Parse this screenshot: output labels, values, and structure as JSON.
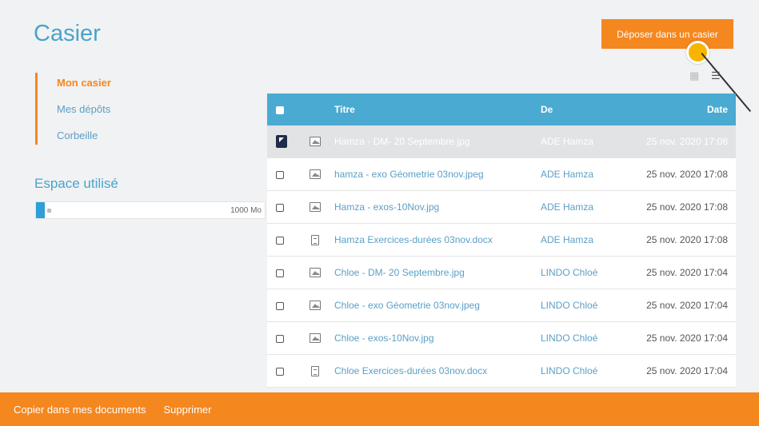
{
  "header": {
    "title": "Casier",
    "deposit_label": "Déposer dans un casier"
  },
  "sidebar": {
    "items": [
      {
        "label": "Mon casier",
        "active": true
      },
      {
        "label": "Mes dépôts",
        "active": false
      },
      {
        "label": "Corbeille",
        "active": false
      }
    ],
    "space": {
      "title": "Espace utilisé",
      "total": "1000 Mo",
      "used_fraction": 0.04
    }
  },
  "view": {
    "grid_icon": "grid-view-icon",
    "list_icon": "list-view-icon",
    "active": "list"
  },
  "table": {
    "headers": {
      "title": "Titre",
      "from": "De",
      "date": "Date"
    },
    "rows": [
      {
        "type": "image",
        "title": "Hamza - DM- 20 Septembre.jpg",
        "from": "ADE Hamza",
        "date": "25 nov. 2020 17:08",
        "selected": true
      },
      {
        "type": "image",
        "title": "hamza - exo Géometrie 03nov.jpeg",
        "from": "ADE Hamza",
        "date": "25 nov. 2020 17:08",
        "selected": false
      },
      {
        "type": "image",
        "title": "Hamza - exos-10Nov.jpg",
        "from": "ADE Hamza",
        "date": "25 nov. 2020 17:08",
        "selected": false
      },
      {
        "type": "document",
        "title": "Hamza Exercices-durées 03nov.docx",
        "from": "ADE Hamza",
        "date": "25 nov. 2020 17:08",
        "selected": false
      },
      {
        "type": "image",
        "title": "Chloe - DM- 20 Septembre.jpg",
        "from": "LINDO Chloé",
        "date": "25 nov. 2020 17:04",
        "selected": false
      },
      {
        "type": "image",
        "title": "Chloe - exo Géometrie 03nov.jpeg",
        "from": "LINDO Chloé",
        "date": "25 nov. 2020 17:04",
        "selected": false
      },
      {
        "type": "image",
        "title": "Chloe - exos-10Nov.jpg",
        "from": "LINDO Chloé",
        "date": "25 nov. 2020 17:04",
        "selected": false
      },
      {
        "type": "document",
        "title": "Chloe Exercices-durées 03nov.docx",
        "from": "LINDO Chloé",
        "date": "25 nov. 2020 17:04",
        "selected": false
      }
    ]
  },
  "bottom_bar": {
    "copy_label": "Copier dans mes documents",
    "delete_label": "Supprimer"
  },
  "colors": {
    "accent": "#f5871f",
    "header_blue": "#4aaad2",
    "title_blue": "#4aa3cc"
  }
}
